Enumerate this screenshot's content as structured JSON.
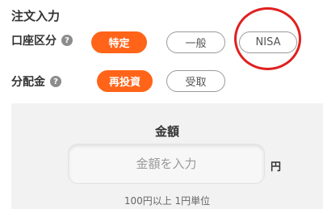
{
  "order": {
    "title": "注文入力",
    "account_type": {
      "label": "口座区分",
      "help": "?",
      "options": [
        "特定",
        "一般",
        "NISA"
      ],
      "selected": "特定"
    },
    "distribution": {
      "label": "分配金",
      "help": "?",
      "options": [
        "再投資",
        "受取"
      ],
      "selected": "再投資"
    }
  },
  "amount": {
    "title": "金額",
    "placeholder": "金額を入力",
    "value": "",
    "unit": "円",
    "hint": "100円以上 1円単位"
  },
  "colors": {
    "accent": "#ff6418",
    "highlight_circle": "#e02020"
  }
}
